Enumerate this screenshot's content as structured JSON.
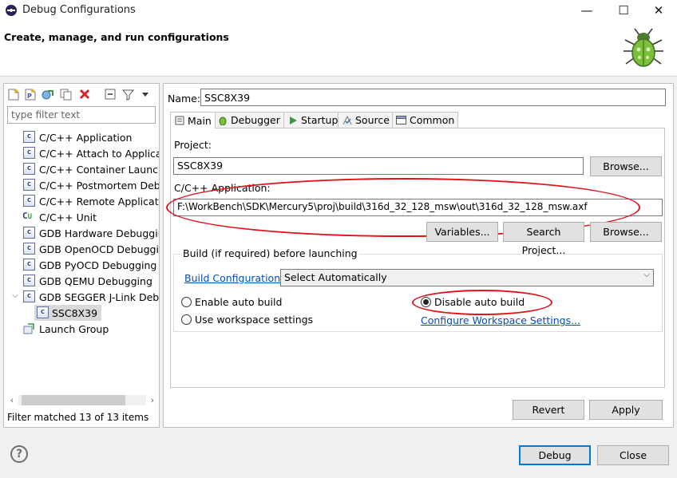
{
  "window": {
    "title": "Debug Configurations",
    "controls": {
      "minimize": "—",
      "maximize": "☐",
      "close": "✕"
    }
  },
  "header": {
    "heading": "Create, manage, and run configurations",
    "banner_icon": "bug-icon"
  },
  "left_pane": {
    "toolbar_icons": [
      "new-config-icon",
      "new-prototype-icon",
      "export-icon",
      "duplicate-icon",
      "delete-icon",
      "collapse-all-icon",
      "filter-icon",
      "view-menu-icon"
    ],
    "filter_placeholder": "type filter text",
    "tree": [
      {
        "label": "C/C++ Application",
        "icon": "c-icon"
      },
      {
        "label": "C/C++ Attach to Applicat",
        "icon": "c-icon"
      },
      {
        "label": "C/C++ Container Launche",
        "icon": "c-icon"
      },
      {
        "label": "C/C++ Postmortem Debu",
        "icon": "c-icon"
      },
      {
        "label": "C/C++ Remote Applicatio",
        "icon": "c-icon"
      },
      {
        "label": "C/C++ Unit",
        "icon": "cunit-icon"
      },
      {
        "label": "GDB Hardware Debuggir",
        "icon": "c-icon"
      },
      {
        "label": "GDB OpenOCD Debuggi",
        "icon": "c-icon"
      },
      {
        "label": "GDB PyOCD Debugging",
        "icon": "c-icon"
      },
      {
        "label": "GDB QEMU Debugging",
        "icon": "c-icon"
      },
      {
        "label": "GDB SEGGER J-Link Debu",
        "icon": "c-icon",
        "expanded": true
      },
      {
        "label": "SSC8X39",
        "icon": "c-icon",
        "child": true,
        "selected": true
      },
      {
        "label": "Launch Group",
        "icon": "launch-group-icon"
      }
    ],
    "scroll": {
      "left": "‹",
      "right": "›"
    },
    "status": "Filter matched 13 of 13 items"
  },
  "right_pane": {
    "name_label": "Name:",
    "name_value": "SSC8X39",
    "tabs": [
      {
        "label": "Main",
        "icon": "main-tab-icon",
        "active": true
      },
      {
        "label": "Debugger",
        "icon": "debugger-icon"
      },
      {
        "label": "Startup",
        "icon": "startup-icon"
      },
      {
        "label": "Source",
        "icon": "source-icon"
      },
      {
        "label": "Common",
        "icon": "common-icon"
      }
    ],
    "project_label": "Project:",
    "project_value": "SSC8X39",
    "browse_label": "Browse...",
    "app_label": "C/C++ Application:",
    "app_value": "F:\\WorkBench\\SDK\\Mercury5\\proj\\build\\316d_32_128_msw\\out\\316d_32_128_msw.axf",
    "variables_label": "Variables...",
    "search_project_label": "Search Project...",
    "browse2_label": "Browse...",
    "build_group_label": "Build (if required) before launching",
    "build_config_link": "Build Configuration:",
    "build_config_value": "Select Automatically",
    "radio_enable": "Enable auto build",
    "radio_disable": "Disable auto build",
    "radio_workspace": "Use workspace settings",
    "configure_link": "Configure Workspace Settings...",
    "revert_label": "Revert",
    "apply_label": "Apply"
  },
  "footer": {
    "help_icon": "?",
    "debug_label": "Debug",
    "close_label": "Close"
  },
  "colors": {
    "annotation": "#e0141b",
    "link": "#0050b4",
    "default_button_border": "#0078d7"
  }
}
